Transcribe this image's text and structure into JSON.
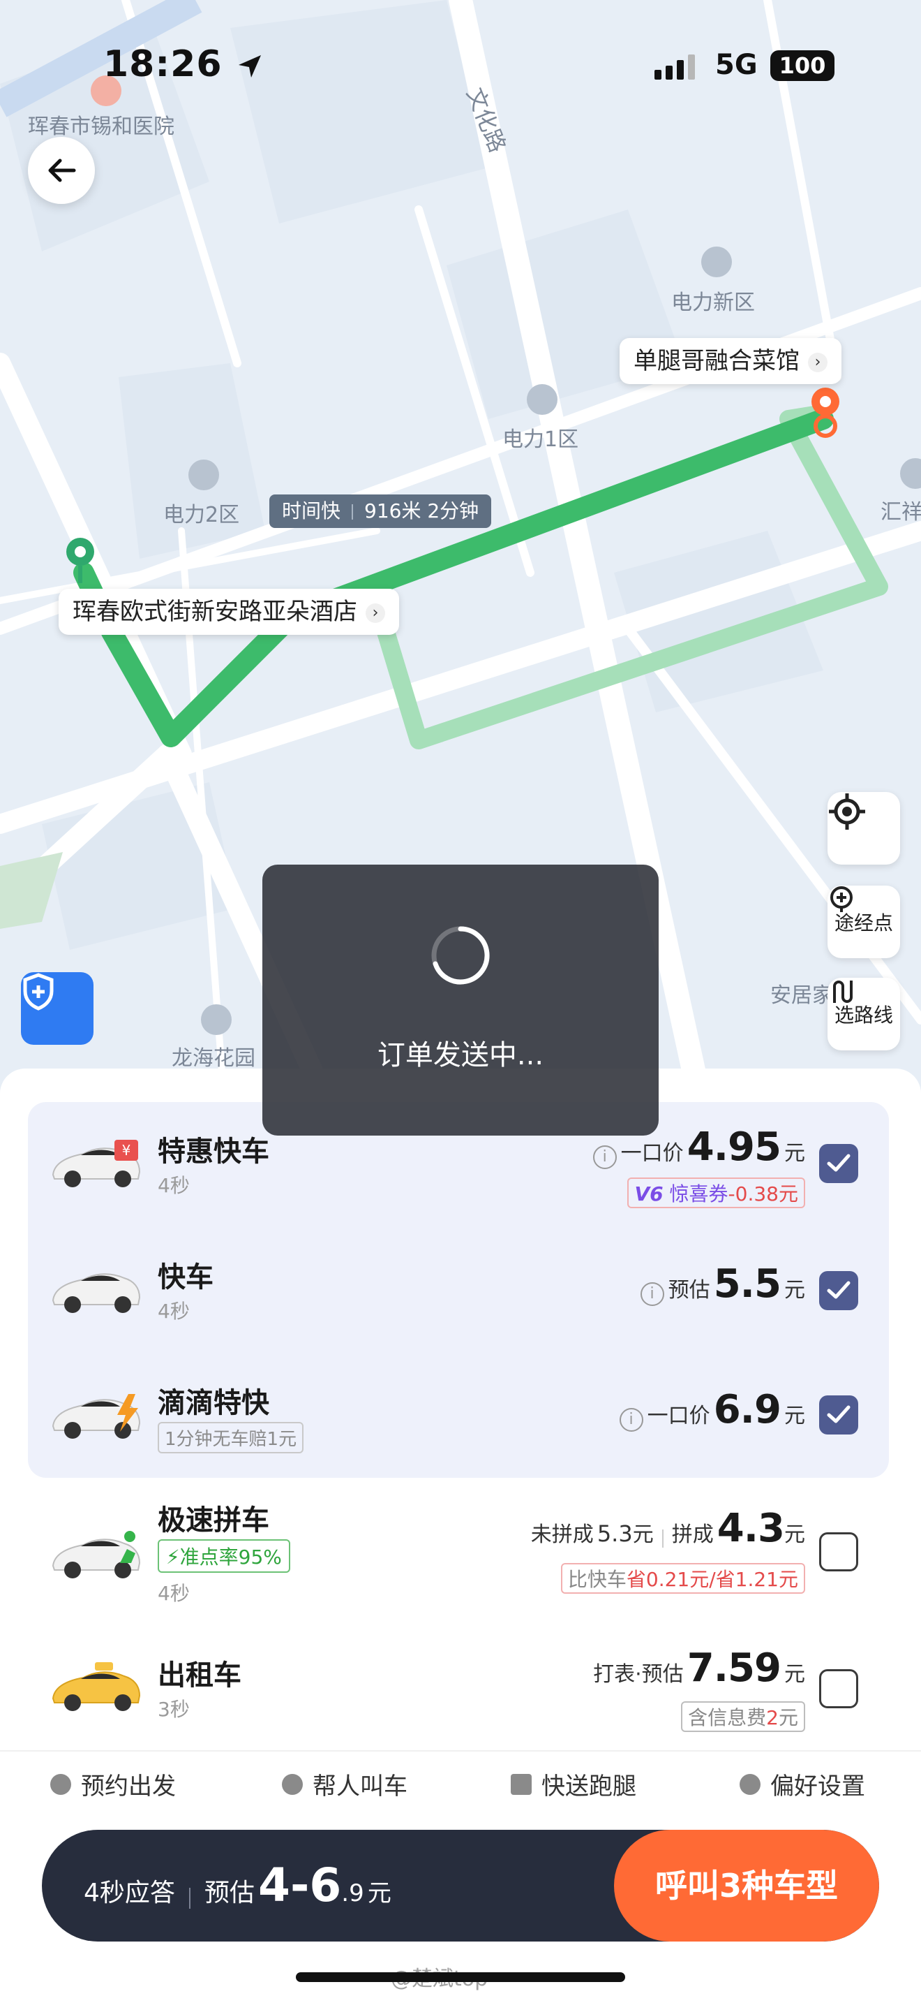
{
  "status_bar": {
    "time": "18:26",
    "network": "5G",
    "battery": "100"
  },
  "map": {
    "labels": {
      "hospital": "珲春市锡和医院",
      "road": "文化路",
      "district_dianli_new": "电力新区",
      "district_dianli1": "电力1区",
      "district_dianli2": "电力2区",
      "huixiang": "汇祥",
      "anju": "安居家园",
      "area_bottom": "龙海花园"
    },
    "origin": "珲春欧式街新安路亚朵酒店",
    "destination": "单腿哥融合菜馆",
    "route_tag": {
      "speed": "时间快",
      "distance_time": "916米 2分钟"
    },
    "buttons": {
      "waypoint": "途经点",
      "route_select": "选路线"
    }
  },
  "toast": {
    "message": "订单发送中..."
  },
  "rides": [
    {
      "name": "特惠快车",
      "eta": "4秒",
      "price_label": "一口价",
      "price": "4.95",
      "unit": "元",
      "coupon_v6": "V6",
      "coupon_label": "惊喜券",
      "coupon_value": "-0.38元",
      "checked": true
    },
    {
      "name": "快车",
      "eta": "4秒",
      "price_label": "预估",
      "price": "5.5",
      "unit": "元",
      "checked": true
    },
    {
      "name": "滴滴特快",
      "tag": "1分钟无车赔1元",
      "price_label": "一口价",
      "price": "6.9",
      "unit": "元",
      "checked": true
    },
    {
      "name": "极速拼车",
      "tag": "准点率95%",
      "eta": "4秒",
      "unpooled_label": "未拼成",
      "unpooled_price": "5.3",
      "pooled_label": "拼成",
      "price": "4.3",
      "unit": "元",
      "note_prefix": "比快车",
      "note_value": "省0.21元/省1.21元",
      "checked": false
    },
    {
      "name": "出租车",
      "eta": "3秒",
      "price_label": "打表·预估",
      "price": "7.59",
      "unit": "元",
      "note_prefix": "含信息费",
      "note_value": "2",
      "note_suffix": "元",
      "checked": false
    }
  ],
  "options": [
    "预约出发",
    "帮人叫车",
    "快送跑腿",
    "偏好设置"
  ],
  "cta": {
    "response": "4秒应答",
    "estimate_label": "预估",
    "range_big": "4-6",
    "range_small": ".9",
    "unit": "元",
    "button": "呼叫3种车型"
  },
  "watermark": "@楚斌top",
  "colors": {
    "accent": "#ff6a35",
    "route": "#3dbb6b",
    "checkbox": "#4f5b91",
    "cta_bg": "#272d3d"
  }
}
